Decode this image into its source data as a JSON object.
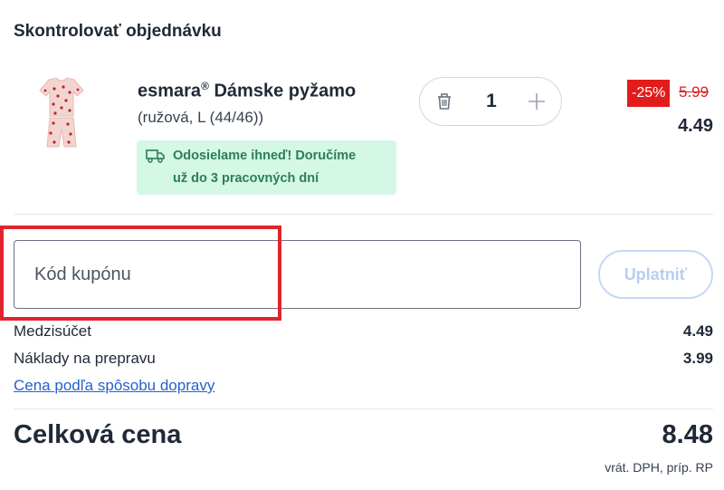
{
  "header": {
    "title": "Skontrolovať objednávku"
  },
  "product": {
    "brand": "esmara",
    "brand_mark": "®",
    "name": "Dámske pyžamo",
    "variant": "(ružová, L (44/46))",
    "shipping_line1": "Odosielame ihneď! Doručíme",
    "shipping_line2": "už do 3 pracovných dní",
    "image_icon": "pajamas-image",
    "quantity": "1",
    "discount_badge": "-25%",
    "old_price": "5.99",
    "price": "4.49"
  },
  "coupon": {
    "placeholder": "Kód kupónu",
    "apply_label": "Uplatniť"
  },
  "summary": {
    "subtotal_label": "Medzisúčet",
    "subtotal_value": "4.49",
    "shipping_label": "Náklady na prepravu",
    "shipping_value": "3.99",
    "shipping_link": "Cena podľa spôsobu dopravy",
    "total_label": "Celková cena",
    "total_value": "8.48",
    "vat_note": "vrát. DPH, príp. RP"
  },
  "colors": {
    "discount_red": "#e21c1c",
    "highlight_red": "#e0242e",
    "link_blue": "#2563c9",
    "banner_green_bg": "#d4f7e6",
    "banner_green_text": "#2e7d5a",
    "apply_disabled": "#b9cdf2"
  }
}
